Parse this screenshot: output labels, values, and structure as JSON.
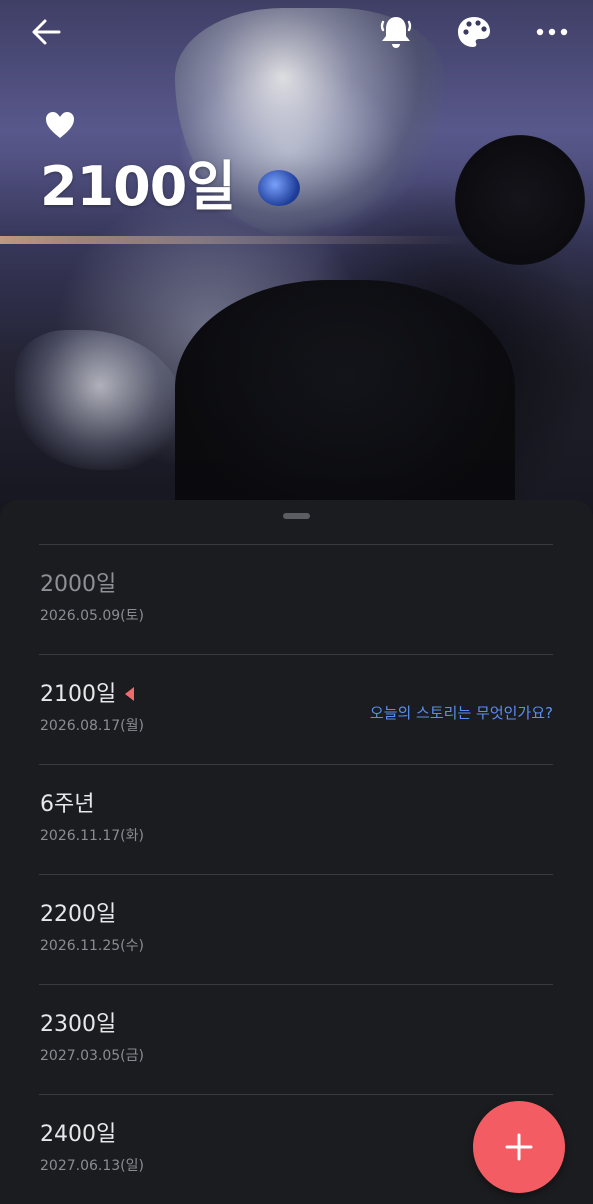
{
  "header": {
    "title": "2100일",
    "icons": [
      "back-arrow-icon",
      "bell-icon",
      "palette-icon",
      "more-icon"
    ],
    "heart_icon": "heart-icon"
  },
  "list": {
    "items": [
      {
        "title": "2000일",
        "date": "2026.05.09(토)",
        "dimmed": true
      },
      {
        "title": "2100일",
        "date": "2026.08.17(월)",
        "current": true,
        "story_prompt": "오늘의 스토리는 무엇인가요?"
      },
      {
        "title": "6주년",
        "date": "2026.11.17(화)"
      },
      {
        "title": "2200일",
        "date": "2026.11.25(수)"
      },
      {
        "title": "2300일",
        "date": "2027.03.05(금)"
      },
      {
        "title": "2400일",
        "date": "2027.06.13(일)"
      }
    ]
  },
  "fab": {
    "icon": "plus-icon"
  },
  "colors": {
    "background": "#1b1c1f",
    "accent_red": "#f45c64",
    "link_blue": "#5b8ef0",
    "divider": "#3a3b41"
  }
}
